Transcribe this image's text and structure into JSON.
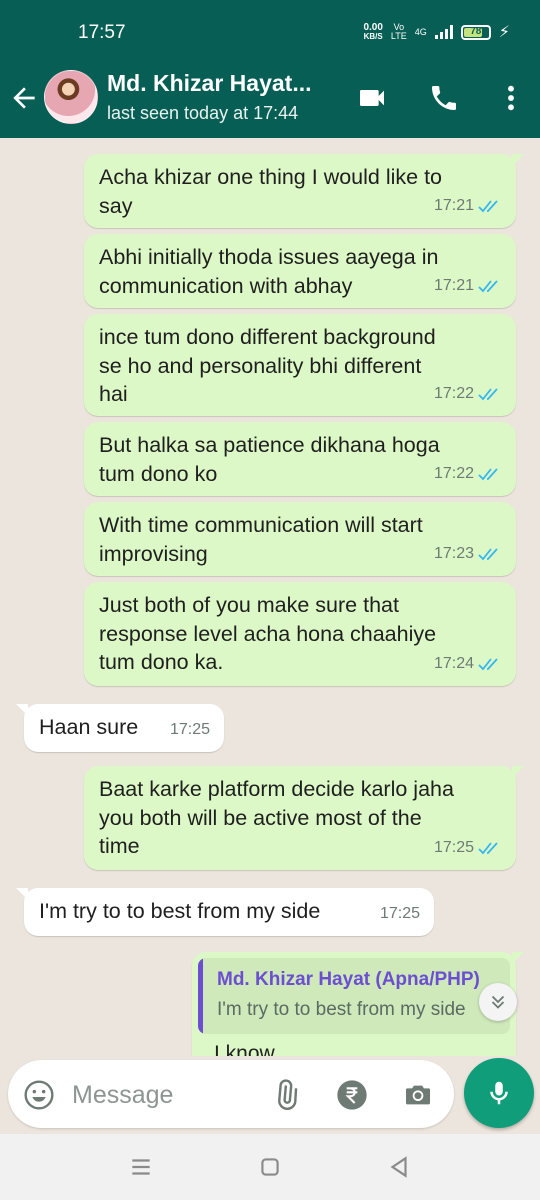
{
  "status_bar": {
    "time": "17:57",
    "net_speed_value": "0.00",
    "net_speed_unit": "KB/S",
    "volte_top": "Vo",
    "volte_bottom": "LTE",
    "network": "4G",
    "battery": "78",
    "battery_level": 0.78
  },
  "header": {
    "contact_name": "Md. Khizar Hayat...",
    "last_seen": "last seen today at 17:44",
    "icons": [
      "back-arrow-icon",
      "video-call-icon",
      "phone-icon",
      "more-vert-icon"
    ]
  },
  "messages": [
    {
      "direction": "out",
      "lines": [
        "Acha khizar one thing I would like to",
        "say"
      ],
      "time": "17:21",
      "read": true
    },
    {
      "direction": "out",
      "lines": [
        "Abhi initially thoda issues aayega in",
        "communication with abhay"
      ],
      "time": "17:21",
      "read": true
    },
    {
      "direction": "out",
      "lines": [
        "ince tum dono different background",
        "se ho and personality bhi different",
        "hai"
      ],
      "time": "17:22",
      "read": true
    },
    {
      "direction": "out",
      "lines": [
        "But halka sa patience dikhana hoga",
        "tum dono ko"
      ],
      "time": "17:22",
      "read": true
    },
    {
      "direction": "out",
      "lines": [
        "With time communication will start",
        "improvising"
      ],
      "time": "17:23",
      "read": true
    },
    {
      "direction": "out",
      "lines": [
        "Just both of you make sure that",
        "response level acha hona chaahiye",
        "tum dono ka."
      ],
      "time": "17:24",
      "read": true
    },
    {
      "direction": "in",
      "lines": [
        "Haan sure"
      ],
      "time": "17:25"
    },
    {
      "direction": "out",
      "lines": [
        "Baat karke platform decide karlo jaha",
        "you both will be active most of the",
        "time"
      ],
      "time": "17:25",
      "read": true
    },
    {
      "direction": "in",
      "lines": [
        "I'm try to to best from my side"
      ],
      "time": "17:25"
    }
  ],
  "reply": {
    "quoted_name": "Md. Khizar Hayat (Apna/PHP)",
    "quoted_text": "I'm try to to best from my side",
    "partial_text": "I know"
  },
  "composer": {
    "placeholder": "Message",
    "icons": [
      "emoji-icon",
      "attach-icon",
      "rupee-icon",
      "camera-icon",
      "mic-icon"
    ]
  },
  "colors": {
    "header": "#075e54",
    "outgoing_bubble": "#dcf8c6",
    "incoming_bubble": "#ffffff",
    "read_ticks": "#34b7f1",
    "mic_button": "#0f9d7a",
    "chat_background": "#ece5dd"
  }
}
